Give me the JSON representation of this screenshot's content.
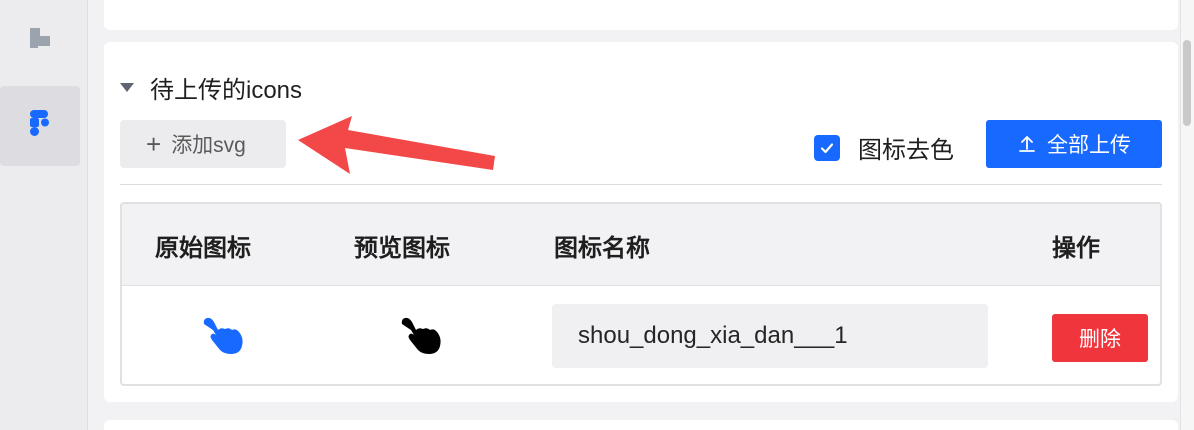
{
  "section": {
    "title": "待上传的icons"
  },
  "toolbar": {
    "add_label": "添加svg",
    "decolor_label": "图标去色",
    "decolor_checked": true,
    "upload_label": "全部上传"
  },
  "table": {
    "headers": [
      "原始图标",
      "预览图标",
      "图标名称",
      "操作"
    ],
    "rows": [
      {
        "name": "shou_dong_xia_dan___1",
        "delete_label": "删除"
      }
    ]
  },
  "colors": {
    "primary": "#1769ff",
    "danger": "#f0353d",
    "annotation_arrow": "#f24848"
  },
  "icons": [
    "puzzle-icon",
    "figma-icon",
    "plus-icon",
    "check-icon",
    "upload-icon",
    "hand-pointer-icon",
    "annotation-arrow"
  ]
}
